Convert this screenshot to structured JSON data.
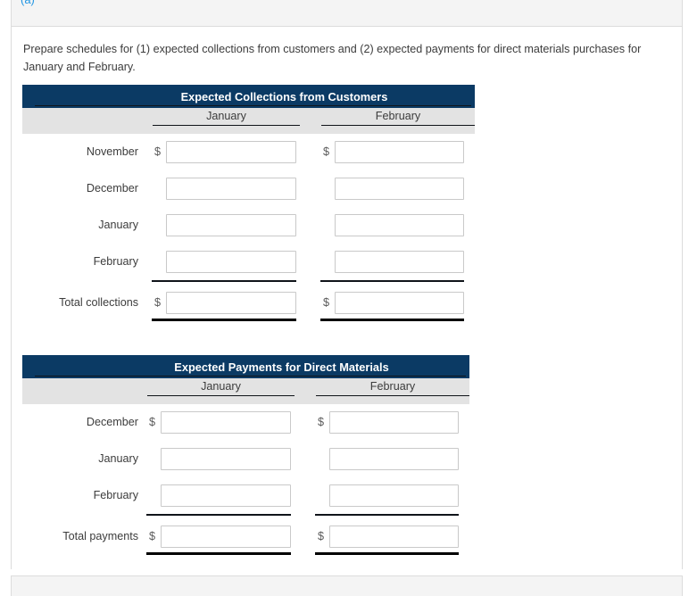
{
  "part": {
    "label": "(a)"
  },
  "instructions": "Prepare schedules for (1) expected collections from customers and (2) expected payments for direct materials purchases for January and February.",
  "colors": {
    "header_navy": "#0b3a64",
    "colhead_gray": "#e3e3e3",
    "part_label_blue": "#2196e3",
    "rule_black": "#10141a",
    "field_border": "#c9c9c9"
  },
  "currency_symbol": "$",
  "schedules": [
    {
      "title": "Expected Collections from Customers",
      "columns": [
        "January",
        "February"
      ],
      "rows": [
        {
          "label": "November",
          "dollar": true,
          "total": false,
          "values": [
            "",
            ""
          ]
        },
        {
          "label": "December",
          "dollar": false,
          "total": false,
          "values": [
            "",
            ""
          ]
        },
        {
          "label": "January",
          "dollar": false,
          "total": false,
          "values": [
            "",
            ""
          ]
        },
        {
          "label": "February",
          "dollar": false,
          "total": false,
          "values": [
            "",
            ""
          ]
        },
        {
          "label": "Total collections",
          "dollar": true,
          "total": true,
          "values": [
            "",
            ""
          ]
        }
      ]
    },
    {
      "title": "Expected Payments for Direct Materials",
      "columns": [
        "January",
        "February"
      ],
      "rows": [
        {
          "label": "December",
          "dollar": true,
          "total": false,
          "values": [
            "",
            ""
          ]
        },
        {
          "label": "January",
          "dollar": false,
          "total": false,
          "values": [
            "",
            ""
          ]
        },
        {
          "label": "February",
          "dollar": false,
          "total": false,
          "values": [
            "",
            ""
          ]
        },
        {
          "label": "Total payments",
          "dollar": true,
          "total": true,
          "values": [
            "",
            ""
          ]
        }
      ]
    }
  ]
}
